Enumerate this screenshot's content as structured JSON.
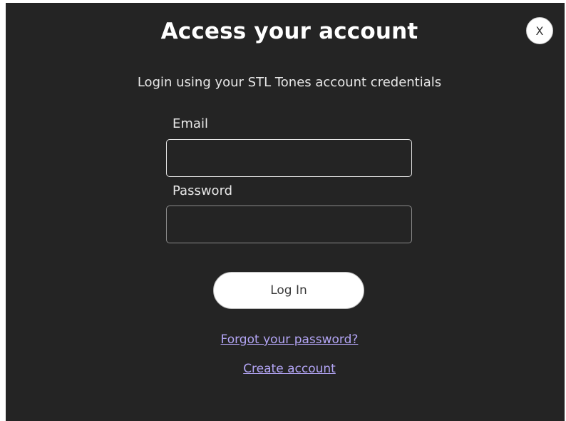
{
  "modal": {
    "title": "Access your account",
    "close_label": "X",
    "subtitle": "Login using your STL Tones account credentials"
  },
  "form": {
    "email_label": "Email",
    "email_value": "",
    "password_label": "Password",
    "password_value": "",
    "login_label": "Log In"
  },
  "links": {
    "forgot_password": "Forgot your password?",
    "create_account": "Create account"
  },
  "colors": {
    "modal_bg": "#242424",
    "link": "#b3a5f5",
    "button_bg": "#ffffff"
  }
}
